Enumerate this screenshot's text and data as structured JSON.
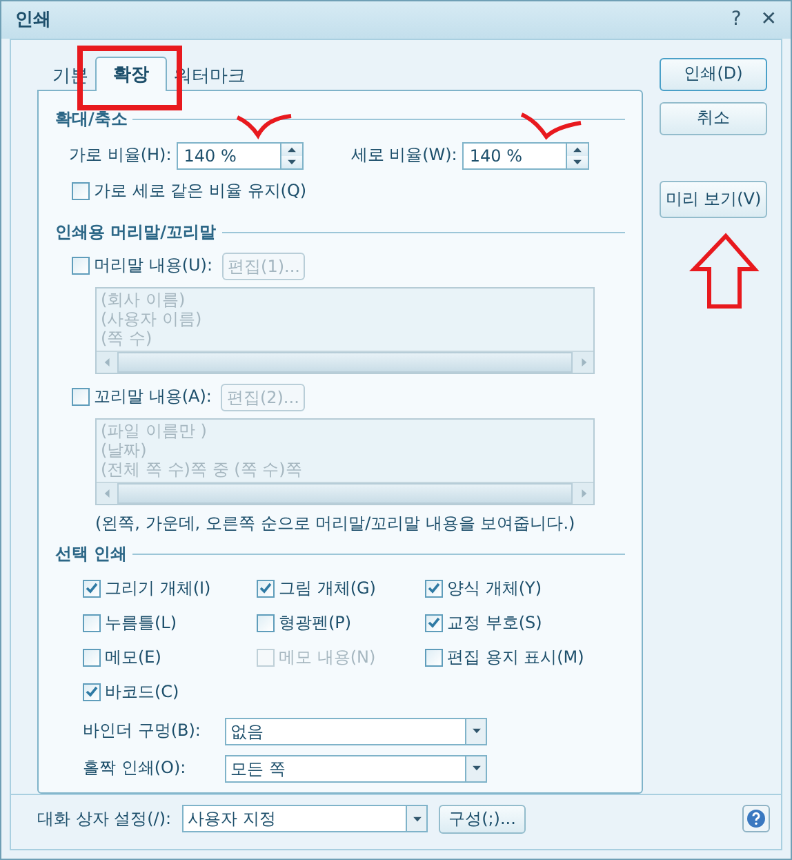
{
  "window": {
    "title": "인쇄",
    "help_glyph": "?",
    "close_glyph": "✕"
  },
  "tabs": [
    {
      "label": "기본",
      "selected": false
    },
    {
      "label": "확장",
      "selected": true
    },
    {
      "label": "워터마크",
      "selected": false
    }
  ],
  "scale": {
    "title": "확대/축소",
    "fields": [
      {
        "label": "가로 비율(H):",
        "value": "140 %"
      },
      {
        "label": "세로 비율(W):",
        "value": "140 %"
      }
    ],
    "keep_ratio": {
      "label": "가로 세로 같은 비율 유지(Q)",
      "checked": false
    }
  },
  "header_footer": {
    "title": "인쇄용 머리말/꼬리말",
    "sections": [
      {
        "label": "머리말 내용(U):",
        "checked": false,
        "edit_button": {
          "label": "편집(1)...",
          "disabled": true
        },
        "lines": [
          "(회사 이름)",
          "(사용자 이름)",
          "(쪽 수)"
        ]
      },
      {
        "label": "꼬리말 내용(A):",
        "checked": false,
        "edit_button": {
          "label": "편집(2)...",
          "disabled": true
        },
        "lines": [
          "(파일 이름만 )",
          "(날짜)",
          "(전체 쪽 수)쪽 중 (쪽 수)쪽"
        ]
      }
    ],
    "note": "(왼쪽, 가운데, 오른쪽 순으로 머리말/꼬리말 내용을 보여줍니다.)"
  },
  "select_print": {
    "title": "선택 인쇄",
    "options": [
      {
        "label": "그리기 개체(I)",
        "checked": true,
        "disabled": false
      },
      {
        "label": "그림 개체(G)",
        "checked": true,
        "disabled": false
      },
      {
        "label": "양식 개체(Y)",
        "checked": true,
        "disabled": false
      },
      {
        "label": "누름틀(L)",
        "checked": false,
        "disabled": false
      },
      {
        "label": "형광펜(P)",
        "checked": false,
        "disabled": false
      },
      {
        "label": "교정 부호(S)",
        "checked": true,
        "disabled": false
      },
      {
        "label": "메모(E)",
        "checked": false,
        "disabled": false
      },
      {
        "label": "메모 내용(N)",
        "checked": false,
        "disabled": true
      },
      {
        "label": "편집 용지 표시(M)",
        "checked": false,
        "disabled": false
      },
      {
        "label": "바코드(C)",
        "checked": true,
        "disabled": false
      }
    ],
    "selects": [
      {
        "label": "바인더 구멍(B):",
        "value": "없음"
      },
      {
        "label": "홀짝 인쇄(O):",
        "value": "모든 쪽"
      }
    ]
  },
  "buttons": [
    {
      "label": "인쇄(D)",
      "default": true
    },
    {
      "label": "취소",
      "default": false
    },
    {
      "label": "미리 보기(V)",
      "default": false
    }
  ],
  "footer": {
    "label": "대화 상자 설정(/):",
    "value": "사용자 지정",
    "button": "구성(;)..."
  }
}
